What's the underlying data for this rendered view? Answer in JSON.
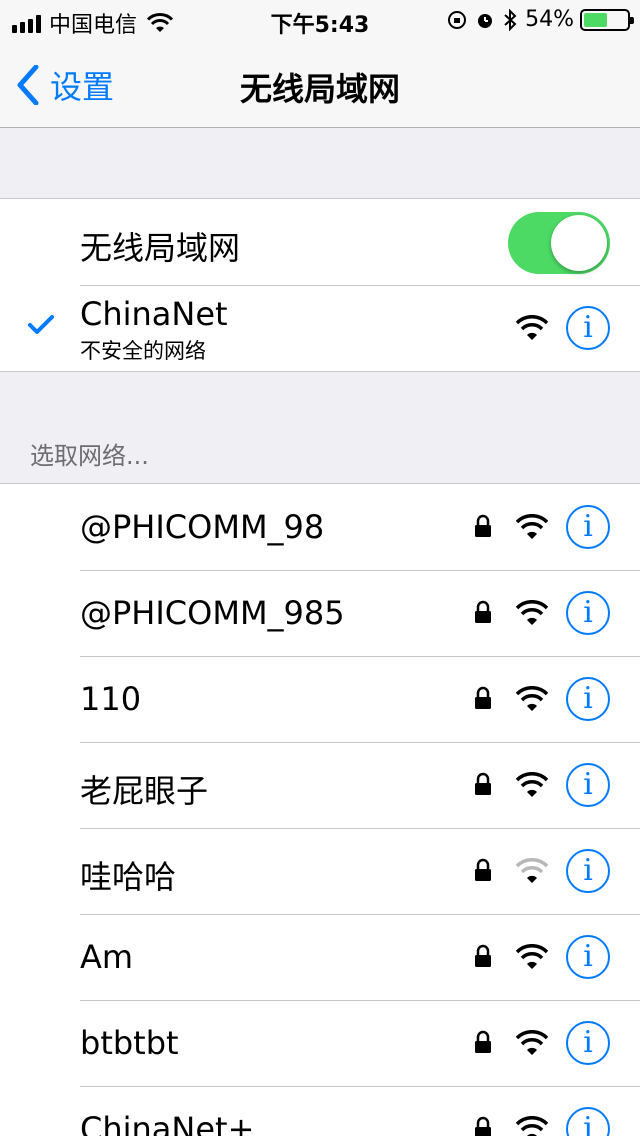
{
  "status_bar": {
    "carrier": "中国电信",
    "time": "下午5:43",
    "battery_percent": "54%",
    "battery_level": 0.54
  },
  "nav": {
    "back_label": "设置",
    "title": "无线局域网"
  },
  "wifi_toggle": {
    "label": "无线局域网",
    "on": true,
    "color": "#4cd964"
  },
  "connected": {
    "name": "ChinaNet",
    "subtitle": "不安全的网络"
  },
  "section_header": "选取网络...",
  "info_glyph": "i",
  "networks": [
    {
      "name": "@PHICOMM_98",
      "locked": true,
      "strength": "full"
    },
    {
      "name": "@PHICOMM_985",
      "locked": true,
      "strength": "full"
    },
    {
      "name": "110",
      "locked": true,
      "strength": "full"
    },
    {
      "name": "老屁眼子",
      "locked": true,
      "strength": "full"
    },
    {
      "name": "哇哈哈",
      "locked": true,
      "strength": "weak"
    },
    {
      "name": "Am",
      "locked": true,
      "strength": "full"
    },
    {
      "name": "btbtbt",
      "locked": true,
      "strength": "full"
    },
    {
      "name": "ChinaNet+",
      "locked": true,
      "strength": "full"
    }
  ],
  "accent_color": "#007aff"
}
